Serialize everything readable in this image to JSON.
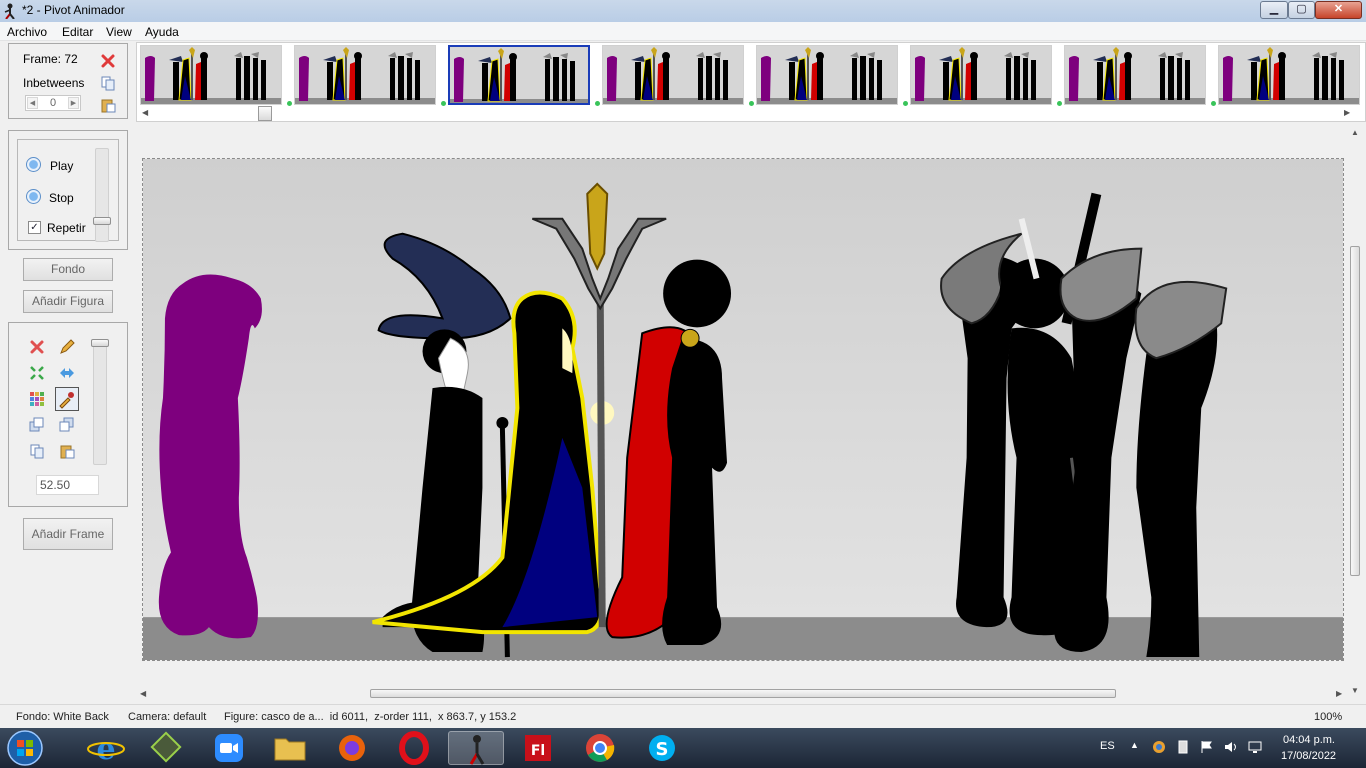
{
  "window": {
    "title": "*2 - Pivot Animador"
  },
  "menu": [
    "Archivo",
    "Editar",
    "View",
    "Ayuda"
  ],
  "frame_panel": {
    "frame_label": "Frame: 72",
    "inbetweens_label": "Inbetweens",
    "inbetweens_value": "0"
  },
  "playback": {
    "play": "Play",
    "stop": "Stop",
    "repeat": "Repetir",
    "repeat_checked": "✓"
  },
  "buttons": {
    "background": "Fondo",
    "add_figure": "Añadir Figura",
    "add_frame": "Añadir Frame"
  },
  "tool_panel": {
    "value": "52.50"
  },
  "timeline": {
    "frame_count_visible": 8,
    "selected_index": 2
  },
  "status": {
    "background": "Fondo: White Back",
    "camera": "Camera: default",
    "figure": "Figure: casco de a...  id 6011,  z-order 111,  x 863.7, y 153.2",
    "zoom": "100%"
  },
  "taskbar": {
    "language": "ES",
    "time": "04:04 p.m.",
    "date": "17/08/2022",
    "apps": [
      "start-button",
      "internet-explorer",
      "file-manager-app",
      "zoom-app",
      "file-explorer",
      "firefox",
      "opera",
      "pivot-animator",
      "flash",
      "chrome",
      "skype"
    ]
  },
  "colors": {
    "purple_figure": "#7e007e",
    "wizard_hat": "#232e55",
    "gold": "#c9a51a",
    "red_cape": "#d10000",
    "selection": "#1a3cb8"
  }
}
